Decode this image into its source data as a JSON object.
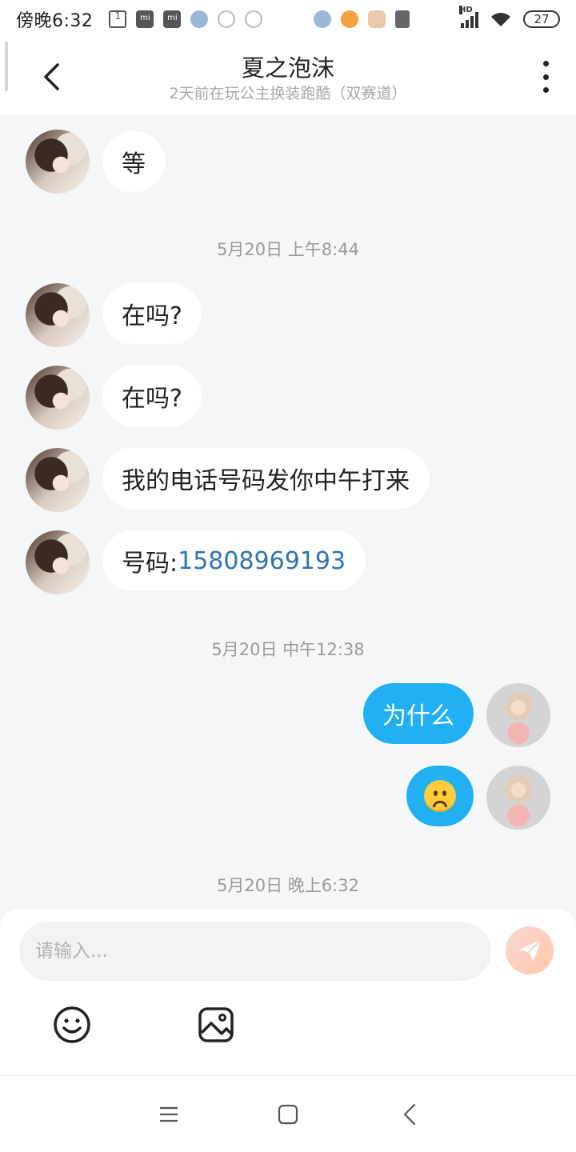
{
  "status_bar": {
    "time": "傍晚6:32",
    "network": "HD",
    "battery": "27"
  },
  "header": {
    "title": "夏之泡沫",
    "subtitle": "2天前在玩公主换装跑酷（双赛道）"
  },
  "messages": {
    "m1": "等",
    "ts1": "5月20日 上午8:44",
    "m2": "在吗?",
    "m3": "在吗?",
    "m4": "我的电话号码发你中午打来",
    "m5_label": "号码:",
    "m5_number": "15808969193",
    "ts2": "5月20日 中午12:38",
    "m6": "为什么",
    "m7_emoji": "worried-face",
    "ts3": "5月20日 晚上6:32"
  },
  "input": {
    "placeholder": "请输入..."
  },
  "colors": {
    "accent": "#22b0f5",
    "link": "#2d74b2",
    "background": "#f5f6f8"
  }
}
